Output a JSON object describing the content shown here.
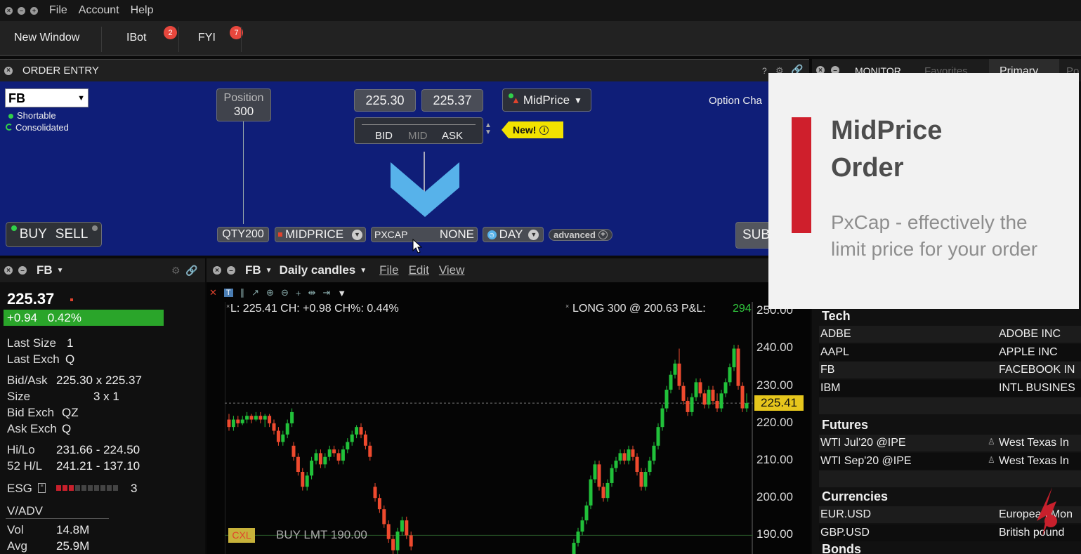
{
  "menu": {
    "file": "File",
    "account": "Account",
    "help": "Help"
  },
  "tabs": {
    "new_window": "New Window",
    "ibot": "IBot",
    "ibot_badge": "2",
    "fyi": "FYI",
    "fyi_badge": "7"
  },
  "order_entry": {
    "title": "ORDER ENTRY",
    "help": "?",
    "symbol": "FB",
    "shortable": "Shortable",
    "consolidated": "Consolidated",
    "position_label": "Position",
    "position_value": "300",
    "bid_price": "225.30",
    "ask_price": "225.37",
    "bid_label": "BID",
    "mid_label": "MID",
    "ask_label": "ASK",
    "order_type_pill": "MidPrice",
    "new_badge": "New!",
    "option_chain": "Option Cha",
    "buy": "BUY",
    "sell": "SELL",
    "qty": "QTY200",
    "order_type": "MIDPRICE",
    "pxcap_label": "PXCAP",
    "pxcap_value": "NONE",
    "tif": "DAY",
    "advanced": "advanced",
    "submit": "SUB"
  },
  "quote": {
    "symbol": "FB",
    "last": "225.37",
    "change": "+0.94",
    "change_pct": "0.42%",
    "last_size_label": "Last Size",
    "last_size": "1",
    "last_exch_label": "Last Exch",
    "last_exch": "Q",
    "bid_ask_label": "Bid/Ask",
    "bid_ask": "225.30 x 225.37",
    "size_label": "Size",
    "size": "3 x 1",
    "bid_exch_label": "Bid Exch",
    "bid_exch": "QZ",
    "ask_exch_label": "Ask Exch",
    "ask_exch": "Q",
    "hilo_label": "Hi/Lo",
    "hilo": "231.66 - 224.50",
    "h52_label": "52 H/L",
    "h52": "241.21 - 137.10",
    "esg_label": "ESG",
    "esg_value": "3",
    "esg_level": 3,
    "vadv_label": "V/ADV",
    "vol_label": "Vol",
    "vol": "14.8M",
    "avg_label": "Avg",
    "avg": "25.9M"
  },
  "chart": {
    "symbol": "FB",
    "period": "Daily candles",
    "menu_file": "File",
    "menu_edit": "Edit",
    "menu_view": "View",
    "info_left": "L: 225.41 CH: +0.98 CH%: 0.44%",
    "info_right": "LONG 300 @ 200.63 P&L:",
    "pnl": "294",
    "last_tag": "225.41",
    "order_tag": "CXL",
    "order_text": "BUY LMT 190.00",
    "colors": {
      "up": "#21c13a",
      "down": "#ef4a2e",
      "last": "#e6c61c"
    }
  },
  "chart_data": {
    "type": "candlestick",
    "y_ticks": [
      "250.00",
      "240.00",
      "230.00",
      "220.00",
      "210.00",
      "200.00",
      "190.00"
    ],
    "ylim": [
      185,
      252.5
    ],
    "last_price": 225.41,
    "order_price": 190,
    "candles": [
      [
        221,
        219,
        222.5,
        218
      ],
      [
        219,
        221,
        222,
        218
      ],
      [
        221,
        220,
        222,
        219
      ],
      [
        220,
        221,
        222,
        219.5
      ],
      [
        221,
        222,
        223,
        220
      ],
      [
        222,
        221,
        222.5,
        220
      ],
      [
        221,
        222,
        223,
        220.5
      ],
      [
        222,
        221,
        223,
        220
      ],
      [
        221,
        222,
        222.5,
        219
      ],
      [
        222,
        220,
        222.5,
        219
      ],
      [
        220,
        218,
        221,
        217
      ],
      [
        218,
        215,
        219,
        214
      ],
      [
        215,
        217,
        218,
        214
      ],
      [
        217,
        220,
        221,
        216
      ],
      [
        220,
        223,
        224,
        219
      ],
      [
        214,
        211,
        215,
        210
      ],
      [
        211,
        207,
        212,
        206
      ],
      [
        207,
        203,
        208,
        202
      ],
      [
        203,
        206,
        207,
        202
      ],
      [
        206,
        210,
        211,
        205
      ],
      [
        210,
        212,
        213,
        209
      ],
      [
        212,
        209,
        213,
        208
      ],
      [
        209,
        211,
        212,
        208
      ],
      [
        211,
        213,
        214,
        210
      ],
      [
        213,
        212,
        214,
        211
      ],
      [
        212,
        210,
        213,
        209
      ],
      [
        210,
        213,
        214,
        209
      ],
      [
        213,
        215,
        216,
        212
      ],
      [
        215,
        217,
        218,
        214
      ],
      [
        217,
        219,
        219.5,
        216
      ],
      [
        219,
        217,
        220,
        216
      ],
      [
        217,
        214,
        218,
        213
      ],
      [
        214,
        211,
        215,
        210
      ],
      [
        203,
        200,
        204,
        199
      ],
      [
        200,
        197,
        201,
        196
      ],
      [
        197,
        193,
        198,
        192
      ],
      [
        193,
        189,
        194,
        188
      ],
      [
        189,
        186,
        190,
        185
      ],
      [
        186,
        191,
        192,
        185
      ],
      [
        191,
        194,
        195,
        190
      ],
      [
        194,
        190,
        195,
        189
      ],
      [
        190,
        187,
        191,
        186
      ]
    ],
    "candles_right": [
      [
        185,
        188,
        189,
        185
      ],
      [
        188,
        191,
        192,
        187
      ],
      [
        191,
        194,
        195,
        190
      ],
      [
        194,
        198,
        199,
        193
      ],
      [
        198,
        205,
        206,
        197
      ],
      [
        205,
        209,
        210,
        204
      ],
      [
        209,
        203,
        210,
        202
      ],
      [
        203,
        200,
        204,
        199
      ],
      [
        200,
        204,
        205,
        199
      ],
      [
        204,
        208,
        209,
        203
      ],
      [
        208,
        210,
        211,
        207
      ],
      [
        210,
        212,
        213,
        209
      ],
      [
        212,
        210,
        213,
        209
      ],
      [
        210,
        213,
        214,
        209
      ],
      [
        213,
        211,
        214,
        210
      ],
      [
        211,
        207,
        212,
        206
      ],
      [
        207,
        203,
        208,
        202
      ],
      [
        203,
        207,
        208,
        202
      ],
      [
        207,
        210,
        211,
        206
      ],
      [
        210,
        214,
        215,
        209
      ],
      [
        214,
        219,
        220,
        213
      ],
      [
        219,
        224,
        225,
        218
      ],
      [
        224,
        229,
        230,
        223
      ],
      [
        229,
        233,
        234,
        228
      ],
      [
        233,
        236,
        237,
        232
      ],
      [
        236,
        230,
        240,
        229
      ],
      [
        230,
        226,
        231,
        225
      ],
      [
        226,
        223,
        227,
        222
      ],
      [
        223,
        227,
        228,
        222
      ],
      [
        227,
        231,
        232,
        226
      ],
      [
        231,
        228,
        232,
        227
      ],
      [
        228,
        225,
        229,
        224
      ],
      [
        225,
        229,
        230,
        224
      ],
      [
        229,
        226,
        230,
        225
      ],
      [
        226,
        224,
        228,
        223
      ],
      [
        224,
        228,
        229,
        223
      ],
      [
        228,
        231,
        232,
        227
      ],
      [
        231,
        235,
        236,
        230
      ],
      [
        235,
        240,
        241,
        234
      ],
      [
        240,
        230,
        241,
        229
      ],
      [
        230,
        224,
        231,
        223
      ],
      [
        224,
        225.4,
        228,
        223
      ]
    ]
  },
  "monitor": {
    "tab_monitor": "MONITOR",
    "tab_favorites": "Favorites",
    "tab_primary": "Primary",
    "tab_more": "Po",
    "groups": [
      {
        "name": "Tech",
        "rows": [
          {
            "sym": "ADBE",
            "name": "ADOBE INC"
          },
          {
            "sym": "AAPL",
            "name": "APPLE INC"
          },
          {
            "sym": "FB",
            "name": "FACEBOOK IN"
          },
          {
            "sym": "IBM",
            "name": "INTL BUSINES"
          }
        ]
      },
      {
        "name": "Futures",
        "rows": [
          {
            "sym": "WTI Jul'20 @IPE",
            "name": "West Texas In"
          },
          {
            "sym": "WTI Sep'20 @IPE",
            "name": "West Texas In"
          }
        ]
      },
      {
        "name": "Currencies",
        "rows": [
          {
            "sym": "EUR.USD",
            "name": "European Mon"
          },
          {
            "sym": "GBP.USD",
            "name": "British pound"
          }
        ]
      },
      {
        "name": "Bonds",
        "rows": []
      }
    ]
  },
  "overlay": {
    "title_line1": "MidPrice",
    "title_line2": "Order",
    "text_line1": "PxCap - effectively the",
    "text_line2": "limit price for your order"
  }
}
